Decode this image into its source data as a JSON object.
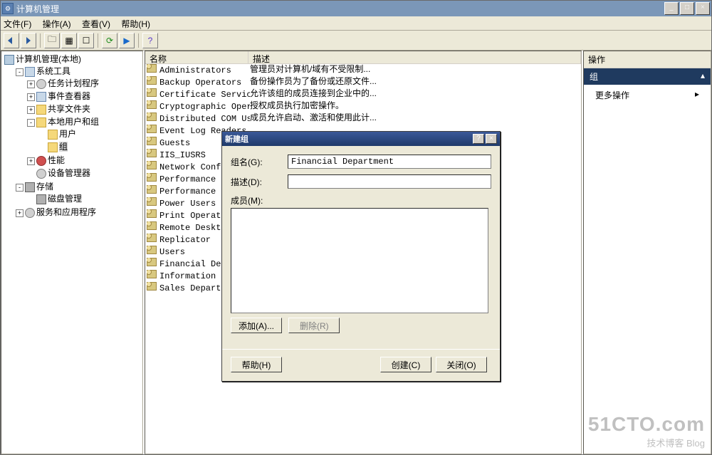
{
  "window": {
    "title": "计算机管理"
  },
  "menus": {
    "file": "文件(F)",
    "action": "操作(A)",
    "view": "查看(V)",
    "help": "帮助(H)"
  },
  "tree": {
    "root": "计算机管理(本地)",
    "sys_tools": "系统工具",
    "task_sched": "任务计划程序",
    "event_viewer": "事件查看器",
    "shared_folders": "共享文件夹",
    "local_users": "本地用户和组",
    "users": "用户",
    "groups": "组",
    "perf": "性能",
    "dev_mgr": "设备管理器",
    "storage": "存储",
    "disk_mgmt": "磁盘管理",
    "services": "服务和应用程序"
  },
  "list": {
    "col_name": "名称",
    "col_desc": "描述",
    "rows": [
      {
        "name": "Administrators",
        "desc": "管理员对计算机/域有不受限制..."
      },
      {
        "name": "Backup Operators",
        "desc": "备份操作员为了备份或还原文件..."
      },
      {
        "name": "Certificate Servic...",
        "desc": "允许该组的成员连接到企业中的..."
      },
      {
        "name": "Cryptographic Oper...",
        "desc": "授权成员执行加密操作。"
      },
      {
        "name": "Distributed COM Users",
        "desc": "成员允许启动、激活和使用此计..."
      },
      {
        "name": "Event Log Readers",
        "desc": ""
      },
      {
        "name": "Guests",
        "desc": ""
      },
      {
        "name": "IIS_IUSRS",
        "desc": ""
      },
      {
        "name": "Network Configu",
        "desc": ""
      },
      {
        "name": "Performance Lo",
        "desc": ""
      },
      {
        "name": "Performance Mon",
        "desc": ""
      },
      {
        "name": "Power Users",
        "desc": ""
      },
      {
        "name": "Print Operators",
        "desc": ""
      },
      {
        "name": "Remote Desktop",
        "desc": ""
      },
      {
        "name": "Replicator",
        "desc": ""
      },
      {
        "name": "Users",
        "desc": ""
      },
      {
        "name": "Financial Depar",
        "desc": ""
      },
      {
        "name": "Information Dep",
        "desc": ""
      },
      {
        "name": "Sales Departmen",
        "desc": ""
      }
    ]
  },
  "actions": {
    "header": "操作",
    "group": "组",
    "more": "更多操作"
  },
  "dialog": {
    "title": "新建组",
    "group_name_label": "组名(G):",
    "group_name_value": "Financial Department",
    "desc_label": "描述(D):",
    "desc_value": "",
    "members_label": "成员(M):",
    "add": "添加(A)...",
    "remove": "删除(R)",
    "help": "帮助(H)",
    "create": "创建(C)",
    "close": "关闭(O)"
  },
  "watermark": {
    "line1": "51CTO.com",
    "line2": "技术博客    Blog"
  }
}
